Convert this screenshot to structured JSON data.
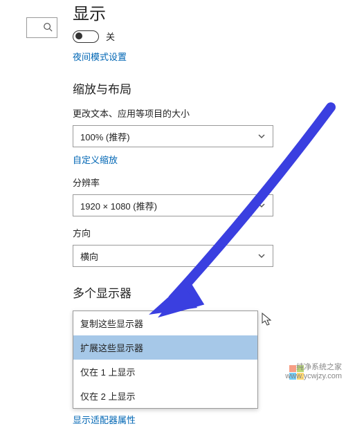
{
  "page": {
    "title": "显示",
    "toggle_label": "关",
    "night_mode_link": "夜间模式设置"
  },
  "scale_section": {
    "heading": "缩放与布局",
    "text_size_label": "更改文本、应用等项目的大小",
    "text_size_value": "100% (推荐)",
    "custom_scale_link": "自定义缩放",
    "resolution_label": "分辨率",
    "resolution_value": "1920 × 1080 (推荐)",
    "orientation_label": "方向",
    "orientation_value": "横向"
  },
  "multi_section": {
    "heading": "多个显示器",
    "options": [
      "复制这些显示器",
      "扩展这些显示器",
      "仅在 1 上显示",
      "仅在 2 上显示"
    ],
    "adapter_link": "显示适配器属性"
  },
  "watermark": {
    "line1": "纯净系统之家",
    "line2": "www.ycwjzy.com"
  }
}
